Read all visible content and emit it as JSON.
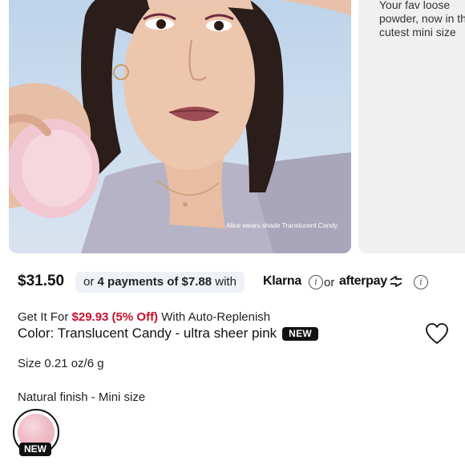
{
  "carousel": {
    "caption": "Alice wears shade Translucent Candy",
    "next_slide_text": "Your fav loose powder, now in the cutest mini size"
  },
  "pricing": {
    "price": "$31.50",
    "installments_prefix": "or ",
    "installments_bold": "4 payments of $7.88",
    "installments_suffix": " with",
    "klarna_label": "Klarna",
    "or_label": "or",
    "afterpay_label": "afterpay"
  },
  "replenish": {
    "prefix": "Get It For ",
    "deal": "$29.93 (5% Off)",
    "suffix": " With Auto-Replenish"
  },
  "color": {
    "label": "Color: Translucent Candy - ultra sheer pink",
    "badge": "NEW"
  },
  "size": {
    "label": "Size 0.21 oz/6 g"
  },
  "finish": {
    "label": "Natural finish - Mini size"
  },
  "swatch": {
    "badge": "NEW",
    "color": "#efbcc7"
  },
  "colors": {
    "deal_red": "#c8102e",
    "badge_black": "#111111"
  },
  "icons": [
    "info-icon",
    "afterpay-arrows-icon",
    "heart-icon"
  ]
}
